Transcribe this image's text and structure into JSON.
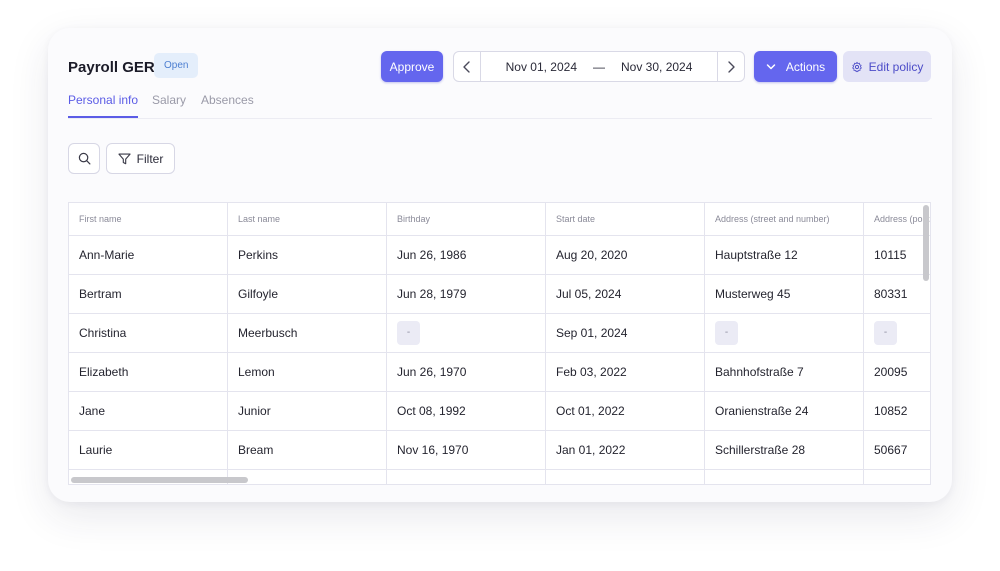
{
  "header": {
    "title": "Payroll GER",
    "status_badge": "Open",
    "approve_label": "Approve",
    "date_start": "Nov 01, 2024",
    "date_separator": "—",
    "date_end": "Nov 30, 2024",
    "actions_label": "Actions",
    "edit_policy_label": "Edit policy"
  },
  "tabs": [
    {
      "label": "Personal info",
      "active": true
    },
    {
      "label": "Salary",
      "active": false
    },
    {
      "label": "Absences",
      "active": false
    }
  ],
  "toolbar": {
    "search_icon": "search-icon",
    "filter_label": "Filter"
  },
  "table": {
    "columns": [
      "First name",
      "Last name",
      "Birthday",
      "Start date",
      "Address (street and number)",
      "Address (postal code)"
    ],
    "rows": [
      [
        "Ann-Marie",
        "Perkins",
        "Jun 26, 1986",
        "Aug 20, 2020",
        "Hauptstraße 12",
        "10115"
      ],
      [
        "Bertram",
        "Gilfoyle",
        "Jun 28, 1979",
        "Jul 05, 2024",
        "Musterweg 45",
        "80331"
      ],
      [
        "Christina",
        "Meerbusch",
        "-",
        "Sep 01, 2024",
        "-",
        "-"
      ],
      [
        "Elizabeth",
        "Lemon",
        "Jun 26, 1970",
        "Feb 03, 2022",
        "Bahnhofstraße 7",
        "20095"
      ],
      [
        "Jane",
        "Junior",
        "Oct 08, 1992",
        "Oct 01, 2022",
        "Oranienstraße 24",
        "10852"
      ],
      [
        "Laurie",
        "Bream",
        "Nov 16, 1970",
        "Jan 01, 2022",
        "Schillerstraße 28",
        "50667"
      ],
      [
        "",
        "",
        "",
        "",
        "",
        ""
      ]
    ]
  },
  "colors": {
    "accent": "#6466ee",
    "badge_bg": "#e4eefb",
    "badge_text": "#4d7fd1",
    "secondary_button_bg": "#e3e3f6"
  }
}
